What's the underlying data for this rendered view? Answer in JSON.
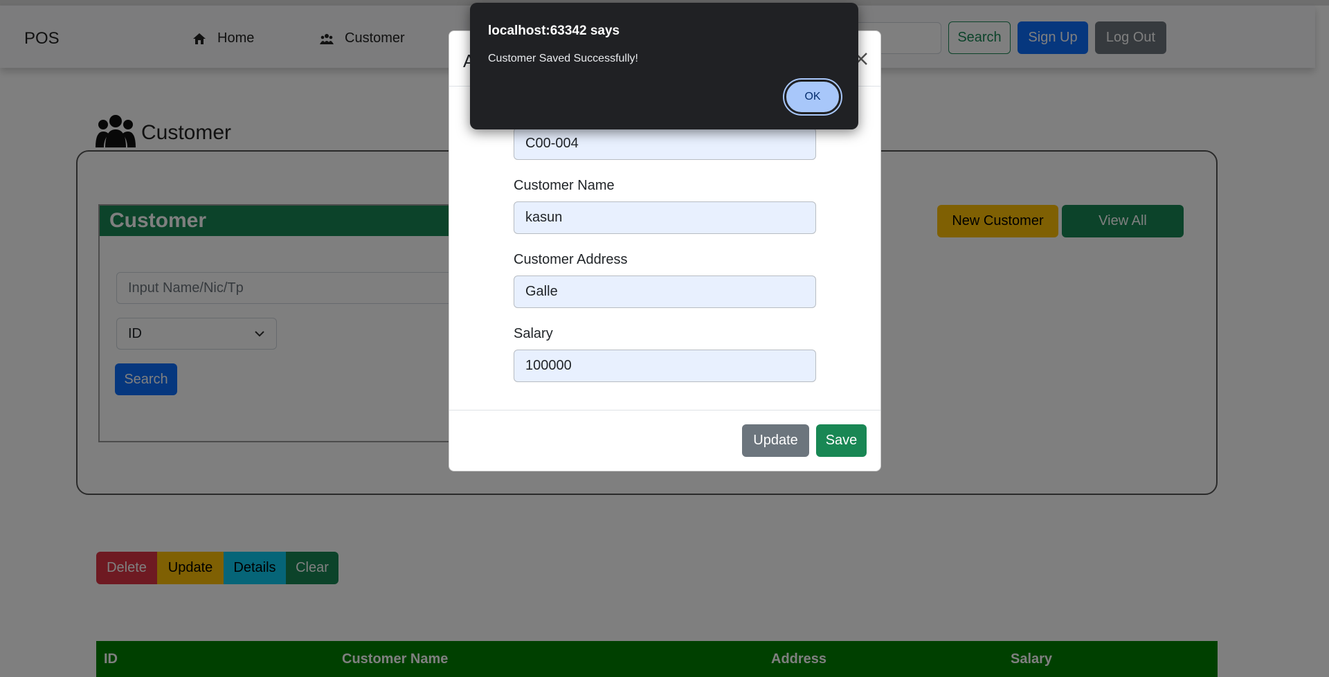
{
  "navbar": {
    "brand": "POS",
    "links": [
      {
        "label": "Home",
        "icon": "home-icon"
      },
      {
        "label": "Customer",
        "icon": "users-icon"
      }
    ],
    "search_label": "Search",
    "signup_label": "Sign Up",
    "logout_label": "Log Out"
  },
  "page": {
    "section_title": "Customer",
    "card_title": "Customer",
    "search_placeholder": "Input Name/Nic/Tp",
    "search_type": "ID",
    "search_button": "Search",
    "new_customer": "New Customer",
    "view_all": "View All"
  },
  "actions": {
    "delete": "Delete",
    "update": "Update",
    "details": "Details",
    "clear": "Clear"
  },
  "table": {
    "columns": [
      "ID",
      "Customer Name",
      "Address",
      "Salary"
    ]
  },
  "modal": {
    "title": "A",
    "id_value": "C00-004",
    "name_label": "Customer Name",
    "name_value": "kasun",
    "address_label": "Customer Address",
    "address_value": "Galle",
    "salary_label": "Salary",
    "salary_value": "100000",
    "update_button": "Update",
    "save_button": "Save"
  },
  "alert": {
    "title": "localhost:63342 says",
    "message": "Customer Saved Successfully!",
    "ok": "OK"
  },
  "colors": {
    "primary": "#0d6efd",
    "success": "#198754",
    "warning": "#ffc107",
    "danger": "#dc3545",
    "info": "#0dcaf0",
    "table_header": "#008000"
  }
}
